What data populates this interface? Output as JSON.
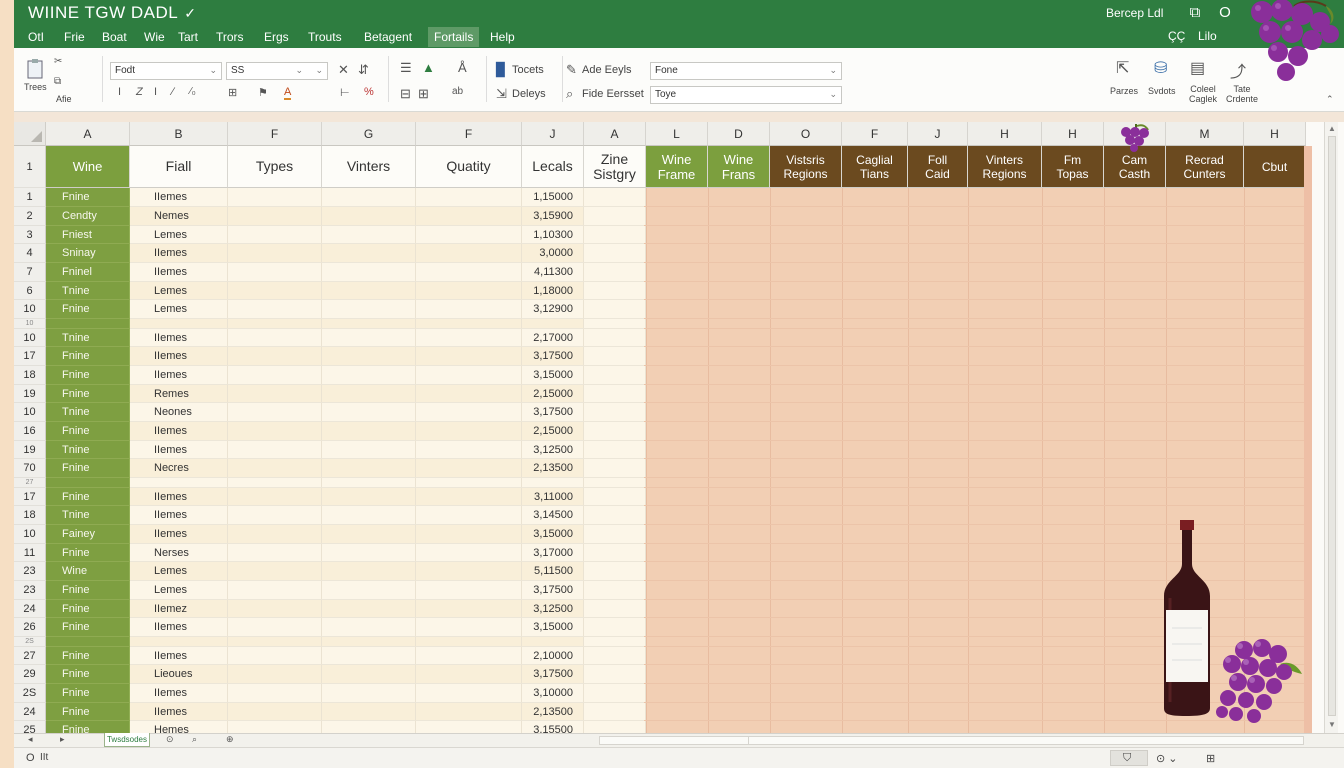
{
  "window": {
    "title": "WIINE TGW DADL",
    "title_mark": "✓",
    "doc_name": "Bercep Ldl",
    "controls": [
      "⧉",
      "O"
    ]
  },
  "menu": {
    "items": [
      "OtI",
      "Frie",
      "Boat",
      "Wie",
      "Tart",
      "Trors",
      "Ergs",
      "Trouts",
      "Betagent",
      "Fortails",
      "Help"
    ],
    "active_index": 9,
    "right_items": [
      "ÇÇ",
      "Lilo"
    ]
  },
  "ribbon": {
    "paste_label": "Trees",
    "paste_sub": "Afie",
    "font_name": "Fodt",
    "font_size": "SS",
    "tools_label": "Tocets",
    "delete_label": "Deleys",
    "add_label": "Ade Eeyls",
    "fide_label": "Fide Eersset",
    "field1_value": "Fone",
    "field2_value": "Toye",
    "right_tools": [
      "Parzes",
      "Svdots",
      "Coleel Caglek",
      "Tate Crdente"
    ],
    "format_glyphs": [
      "I",
      "Z",
      "I",
      "∕",
      "∕₀",
      "A"
    ]
  },
  "columns": [
    {
      "letter": "A",
      "header": "Wine",
      "style": "wine"
    },
    {
      "letter": "B",
      "header": "Fiall",
      "style": "white"
    },
    {
      "letter": "F",
      "header": "Types",
      "style": "white"
    },
    {
      "letter": "G",
      "header": "Vinters",
      "style": "white"
    },
    {
      "letter": "F",
      "header": "Quatity",
      "style": "white"
    },
    {
      "letter": "J",
      "header": "Lecals",
      "style": "white"
    },
    {
      "letter": "A",
      "header": "Zine\nSistgry",
      "style": "white"
    },
    {
      "letter": "L",
      "header": "Wine\nFrame",
      "style": "wine"
    },
    {
      "letter": "D",
      "header": "Wine\nFrans",
      "style": "wine"
    },
    {
      "letter": "O",
      "header": "Vistsris\nRegions",
      "style": "brown"
    },
    {
      "letter": "F",
      "header": "Caglial\nTians",
      "style": "brown"
    },
    {
      "letter": "J",
      "header": "Foll\nCaid",
      "style": "brown"
    },
    {
      "letter": "H",
      "header": "Vinters\nRegions",
      "style": "brown"
    },
    {
      "letter": "H",
      "header": "Fm\nTopas",
      "style": "brown"
    },
    {
      "letter": "",
      "header": "Cam\nCasth",
      "style": "brown"
    },
    {
      "letter": "M",
      "header": "Recrad\nCunters",
      "style": "brown"
    },
    {
      "letter": "H",
      "header": "Cbut",
      "style": "brown"
    }
  ],
  "header_row_number": "1",
  "rows": [
    {
      "num": "1",
      "a": "Fnine",
      "b": "IIemes",
      "j": "1,15000"
    },
    {
      "num": "2",
      "a": "Cendty",
      "b": "Nemes",
      "j": "3,15900"
    },
    {
      "num": "3",
      "a": "Fniest",
      "b": "Lemes",
      "j": "1,10300"
    },
    {
      "num": "4",
      "a": "Sninay",
      "b": "IIemes",
      "j": "3,0000"
    },
    {
      "num": "7",
      "a": "Fninel",
      "b": "IIemes",
      "j": "4,11300"
    },
    {
      "num": "6",
      "a": "Tnine",
      "b": "Lemes",
      "j": "1,18000"
    },
    {
      "num": "10",
      "a": "Fnine",
      "b": "Lemes",
      "j": "3,12900"
    },
    {
      "num": "10",
      "a": "",
      "b": "",
      "j": "",
      "gap": true
    },
    {
      "num": "10",
      "a": "Tnine",
      "b": "IIemes",
      "j": "2,17000"
    },
    {
      "num": "17",
      "a": "Fnine",
      "b": "IIemes",
      "j": "3,17500"
    },
    {
      "num": "18",
      "a": "Fnine",
      "b": "IIemes",
      "j": "3,15000"
    },
    {
      "num": "19",
      "a": "Fnine",
      "b": "Remes",
      "j": "2,15000"
    },
    {
      "num": "10",
      "a": "Tnine",
      "b": "Neones",
      "j": "3,17500"
    },
    {
      "num": "16",
      "a": "Fnine",
      "b": "IIemes",
      "j": "2,15000"
    },
    {
      "num": "19",
      "a": "Tnine",
      "b": "IIemes",
      "j": "3,12500"
    },
    {
      "num": "70",
      "a": "Fnine",
      "b": "Necres",
      "j": "2,13500"
    },
    {
      "num": "27",
      "a": "",
      "b": "",
      "j": "",
      "gap": true
    },
    {
      "num": "17",
      "a": "Fnine",
      "b": "IIemes",
      "j": "3,11000"
    },
    {
      "num": "18",
      "a": "Tnine",
      "b": "IIemes",
      "j": "3,14500"
    },
    {
      "num": "10",
      "a": "Fainey",
      "b": "IIemes",
      "j": "3,15000"
    },
    {
      "num": "11",
      "a": "Fnine",
      "b": "Nerses",
      "j": "3,17000"
    },
    {
      "num": "23",
      "a": "Wine",
      "b": "Lemes",
      "j": "5,11500"
    },
    {
      "num": "23",
      "a": "Fnine",
      "b": "Lemes",
      "j": "3,17500"
    },
    {
      "num": "24",
      "a": "Fnine",
      "b": "IIemez",
      "j": "3,12500"
    },
    {
      "num": "26",
      "a": "Fnine",
      "b": "IIemes",
      "j": "3,15000"
    },
    {
      "num": "2S",
      "a": "",
      "b": "",
      "j": "",
      "gap": true
    },
    {
      "num": "27",
      "a": "Fnine",
      "b": "IIemes",
      "j": "2,10000"
    },
    {
      "num": "29",
      "a": "Fnine",
      "b": "Lieoues",
      "j": "3,17500"
    },
    {
      "num": "2S",
      "a": "Fnine",
      "b": "IIemes",
      "j": "3,10000"
    },
    {
      "num": "24",
      "a": "Fnine",
      "b": "IIemes",
      "j": "2,13500"
    },
    {
      "num": "25",
      "a": "Fnine",
      "b": "Hemes",
      "j": "3,15500"
    }
  ],
  "sheet_tab": "Twsdsodes",
  "status": {
    "left": "O",
    "left2": "IIt",
    "right": [
      "⛉",
      "⊙ ⌄",
      "⊞"
    ]
  },
  "colors": {
    "title_green": "#2e7d40",
    "wine_green": "#7e9f41",
    "header_brown": "#6b4a1f",
    "pink_zone": "#f2cfb4",
    "grape_purple": "#7b2a8c",
    "bottle": "#4a1a1c"
  }
}
